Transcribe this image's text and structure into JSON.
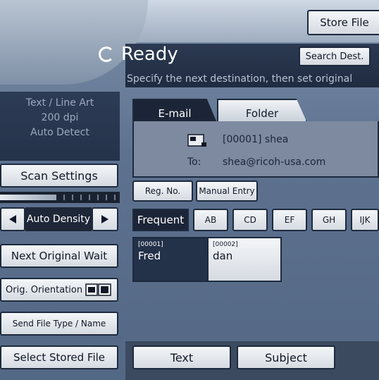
{
  "header": {
    "store_file_label": "Store File",
    "status": "Ready",
    "search_dest_label": "Search Dest.",
    "instruction": "Specify the next destination, then set original"
  },
  "scan_info": {
    "line1": "Text / Line Art",
    "line2": "200 dpi",
    "line3": "Auto Detect"
  },
  "left_buttons": {
    "scan_settings": "Scan Settings",
    "auto_density": "Auto Density",
    "next_original_wait": "Next Original Wait",
    "orig_orientation": "Orig. Orientation",
    "send_file_type": "Send File Type / Name",
    "select_stored_file": "Select Stored File"
  },
  "tabs": [
    "E-mail",
    "Folder"
  ],
  "destination": {
    "entry": "[00001] shea",
    "to_label": "To:",
    "to_address": "shea@ricoh-usa.com"
  },
  "action_buttons": {
    "reg_no": "Reg. No.",
    "manual_entry": "Manual Entry"
  },
  "index_tabs": [
    "Frequent",
    "AB",
    "CD",
    "EF",
    "GH",
    "IJK"
  ],
  "address_entries": [
    {
      "code": "[00001]",
      "name": "Fred",
      "selected": true
    },
    {
      "code": "[00002]",
      "name": "dan",
      "selected": false
    }
  ],
  "bottom_buttons": {
    "text": "Text",
    "subject": "Subject"
  },
  "colors": {
    "selected": "#1c2537",
    "button": "#e8ebef",
    "accent": "#0b1a3a"
  },
  "icons": {
    "ready": "ready-icon",
    "email": "email-icon",
    "left_arrow": "arrow-left-icon",
    "right_arrow": "arrow-right-icon",
    "orientation": "orientation-icon"
  }
}
